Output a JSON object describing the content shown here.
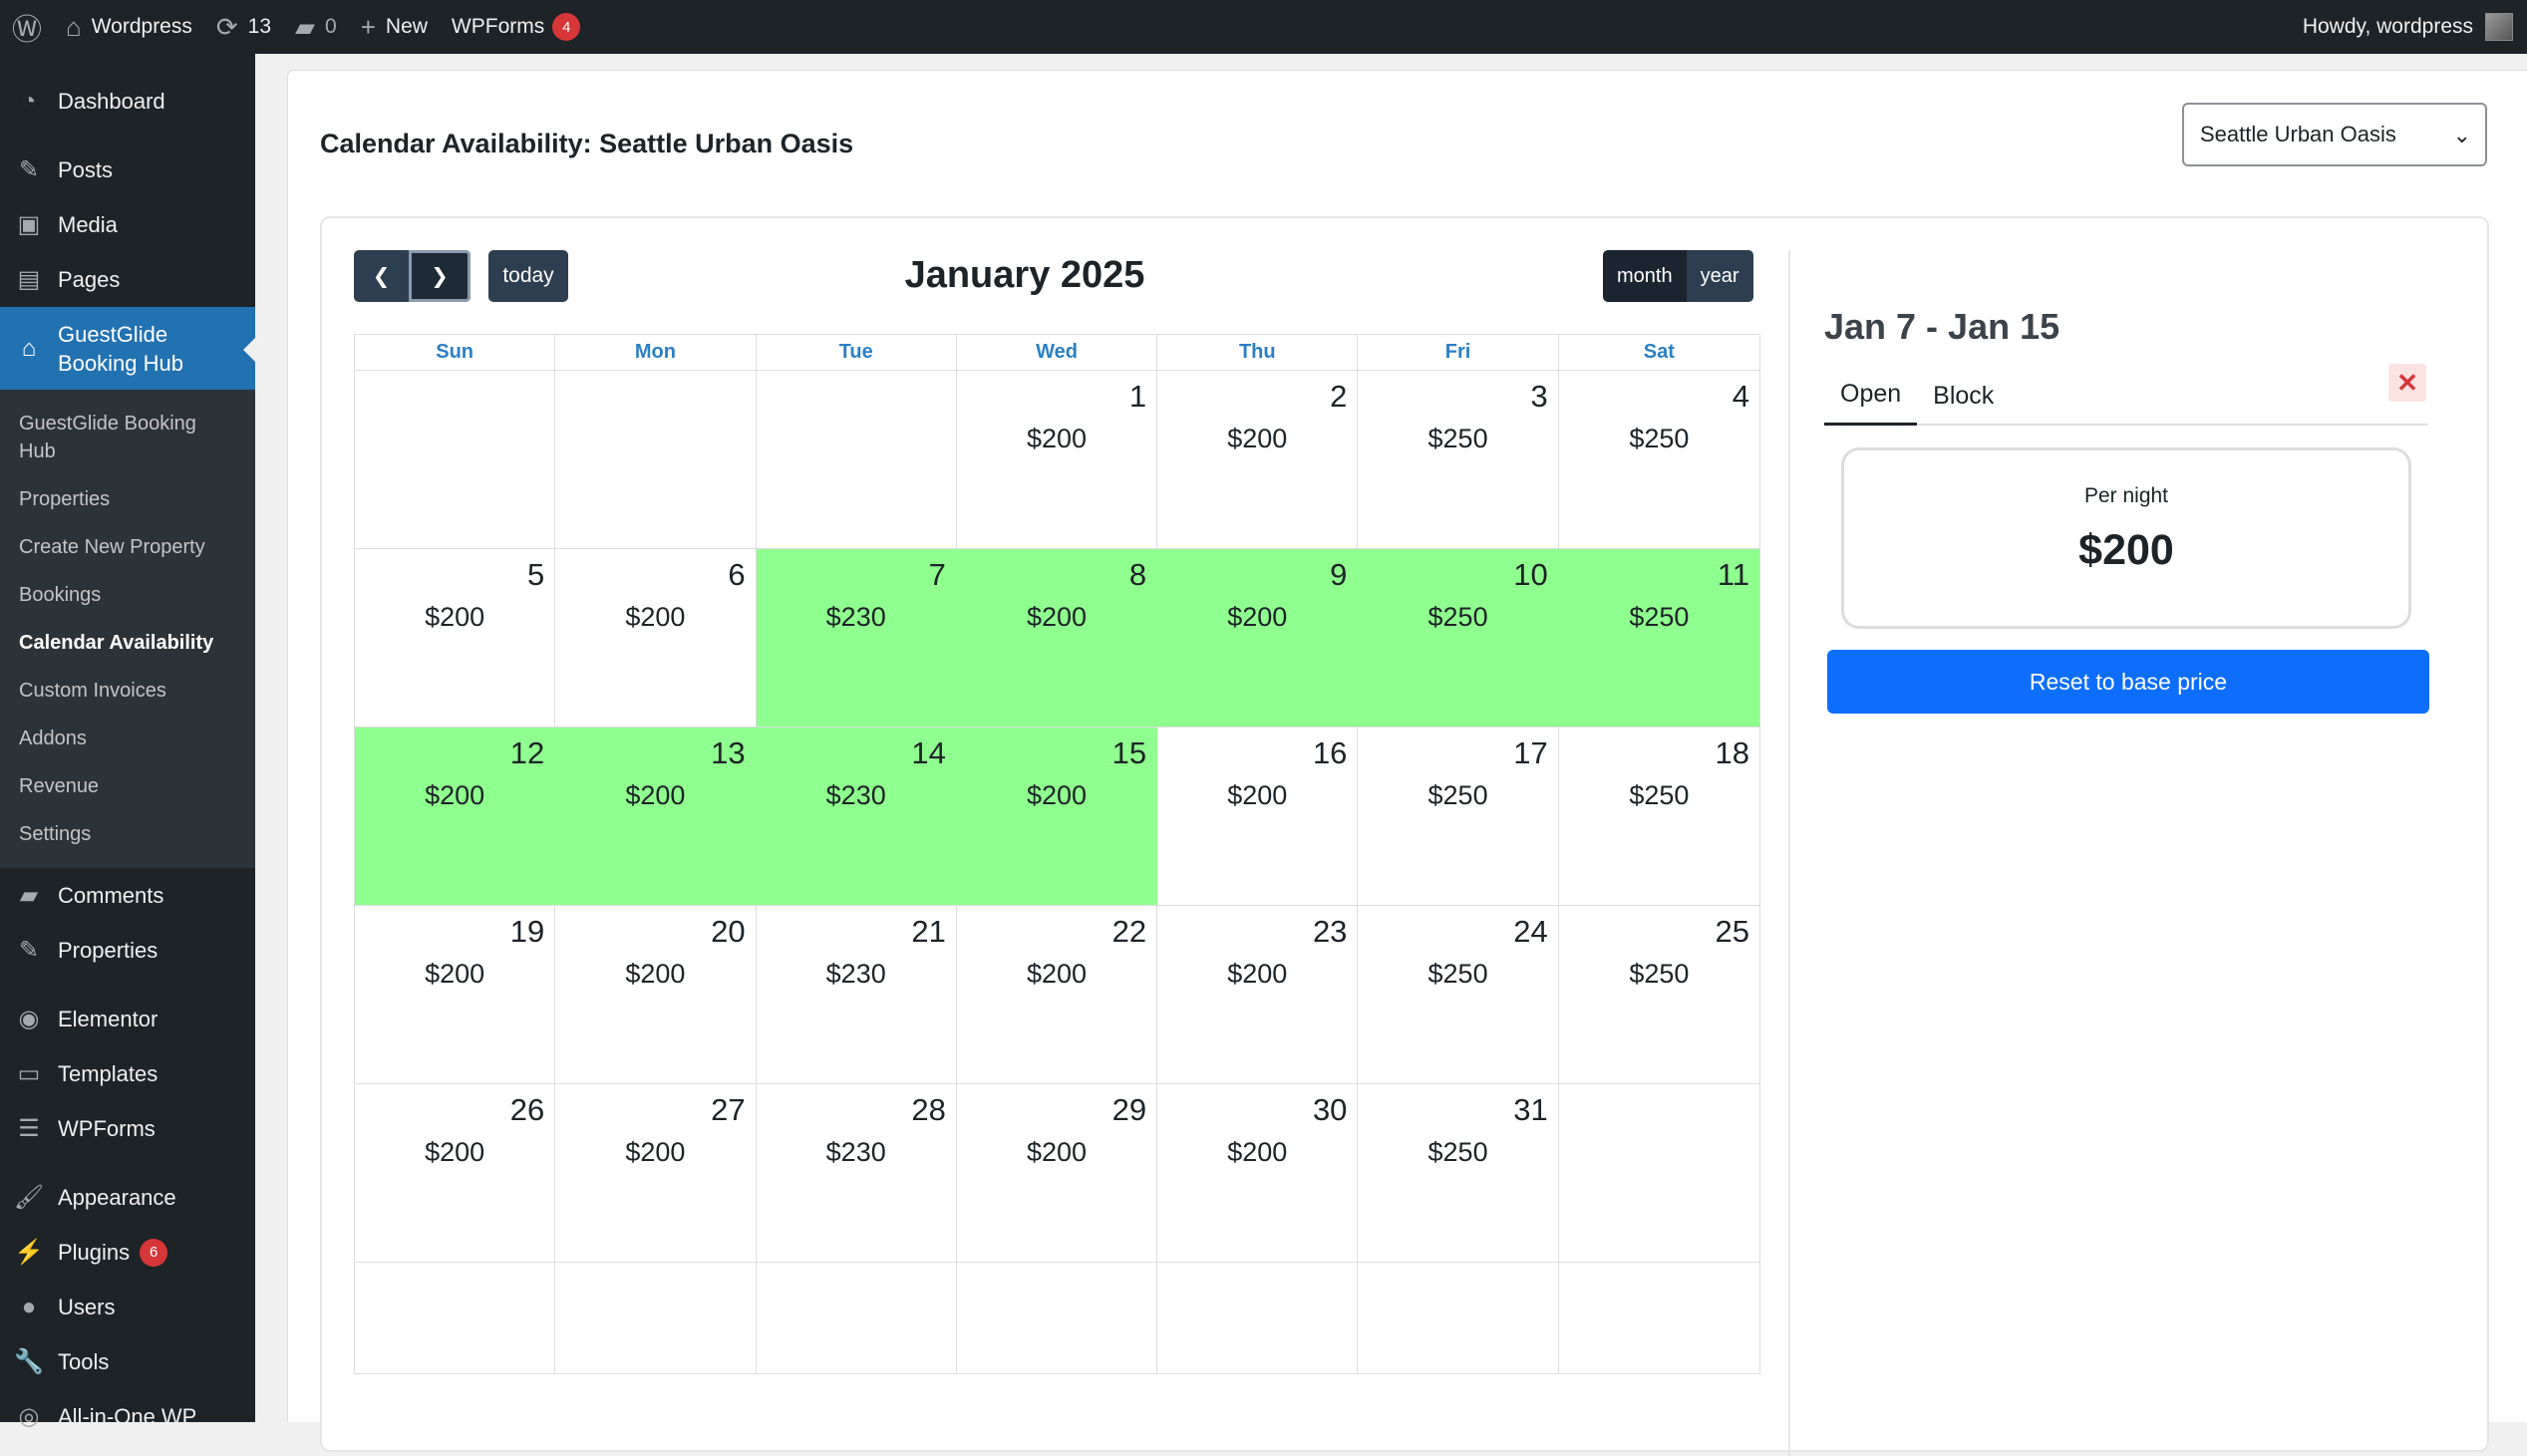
{
  "adminbar": {
    "site_name": "Wordpress",
    "updates_count": "13",
    "comments_count": "0",
    "new_label": "New",
    "wpforms_label": "WPForms",
    "wpforms_badge": "4",
    "howdy": "Howdy, wordpress"
  },
  "sidebar": {
    "dashboard": "Dashboard",
    "posts": "Posts",
    "media": "Media",
    "pages": "Pages",
    "guestglide": "GuestGlide Booking Hub",
    "submenu": [
      "GuestGlide Booking Hub",
      "Properties",
      "Create New Property",
      "Bookings",
      "Calendar Availability",
      "Custom Invoices",
      "Addons",
      "Revenue",
      "Settings"
    ],
    "comments": "Comments",
    "properties": "Properties",
    "elementor": "Elementor",
    "templates": "Templates",
    "wpforms": "WPForms",
    "appearance": "Appearance",
    "plugins": "Plugins",
    "plugins_badge": "6",
    "users": "Users",
    "tools": "Tools",
    "aio": "All-in-One WP"
  },
  "page": {
    "title": "Calendar Availability: Seattle Urban Oasis",
    "property_select": "Seattle Urban Oasis"
  },
  "calendar": {
    "title": "January 2025",
    "today_label": "today",
    "view_month": "month",
    "view_year": "year",
    "weekdays": [
      "Sun",
      "Mon",
      "Tue",
      "Wed",
      "Thu",
      "Fri",
      "Sat"
    ],
    "weeks": [
      [
        {
          "d": "",
          "p": ""
        },
        {
          "d": "",
          "p": ""
        },
        {
          "d": "",
          "p": ""
        },
        {
          "d": "1",
          "p": "$200"
        },
        {
          "d": "2",
          "p": "$200"
        },
        {
          "d": "3",
          "p": "$250"
        },
        {
          "d": "4",
          "p": "$250"
        }
      ],
      [
        {
          "d": "5",
          "p": "$200"
        },
        {
          "d": "6",
          "p": "$200"
        },
        {
          "d": "7",
          "p": "$230",
          "sel": true
        },
        {
          "d": "8",
          "p": "$200",
          "sel": true
        },
        {
          "d": "9",
          "p": "$200",
          "sel": true
        },
        {
          "d": "10",
          "p": "$250",
          "sel": true
        },
        {
          "d": "11",
          "p": "$250",
          "sel": true
        }
      ],
      [
        {
          "d": "12",
          "p": "$200",
          "sel": true
        },
        {
          "d": "13",
          "p": "$200",
          "sel": true
        },
        {
          "d": "14",
          "p": "$230",
          "sel": true
        },
        {
          "d": "15",
          "p": "$200",
          "sel": true
        },
        {
          "d": "16",
          "p": "$200"
        },
        {
          "d": "17",
          "p": "$250"
        },
        {
          "d": "18",
          "p": "$250"
        }
      ],
      [
        {
          "d": "19",
          "p": "$200"
        },
        {
          "d": "20",
          "p": "$200"
        },
        {
          "d": "21",
          "p": "$230"
        },
        {
          "d": "22",
          "p": "$200"
        },
        {
          "d": "23",
          "p": "$200"
        },
        {
          "d": "24",
          "p": "$250"
        },
        {
          "d": "25",
          "p": "$250"
        }
      ],
      [
        {
          "d": "26",
          "p": "$200"
        },
        {
          "d": "27",
          "p": "$200"
        },
        {
          "d": "28",
          "p": "$230"
        },
        {
          "d": "29",
          "p": "$200"
        },
        {
          "d": "30",
          "p": "$200"
        },
        {
          "d": "31",
          "p": "$250"
        },
        {
          "d": "",
          "p": ""
        }
      ],
      [
        {
          "d": "",
          "p": ""
        },
        {
          "d": "",
          "p": ""
        },
        {
          "d": "",
          "p": ""
        },
        {
          "d": "",
          "p": ""
        },
        {
          "d": "",
          "p": ""
        },
        {
          "d": "",
          "p": ""
        },
        {
          "d": "",
          "p": ""
        }
      ]
    ],
    "selected_color": "#8fff8f"
  },
  "panel": {
    "range": "Jan 7 - Jan 15",
    "tab_open": "Open",
    "tab_block": "Block",
    "per_night_label": "Per night",
    "per_night_value": "$200",
    "reset_label": "Reset to base price"
  }
}
